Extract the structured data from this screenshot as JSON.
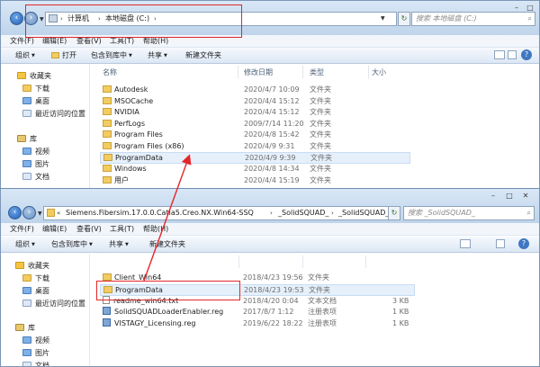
{
  "window1": {
    "address": [
      "计算机",
      "本地磁盘 (C:)"
    ],
    "search_placeholder": "搜索 本地磁盘 (C:)",
    "menu": [
      "文件(F)",
      "编辑(E)",
      "查看(V)",
      "工具(T)",
      "帮助(H)"
    ],
    "commands": [
      "组织",
      "打开",
      "包含到库中",
      "共享",
      "新建文件夹"
    ],
    "nav": [
      "收藏夹",
      "下载",
      "桌面",
      "最近访问的位置",
      "库",
      "视频",
      "图片",
      "文档"
    ],
    "headers": [
      "名称",
      "修改日期",
      "类型",
      "大小"
    ],
    "files": [
      {
        "name": "Autodesk",
        "date": "2020/4/7 10:09",
        "type": "文件夹",
        "size": ""
      },
      {
        "name": "MSOCache",
        "date": "2020/4/4 15:12",
        "type": "文件夹",
        "size": ""
      },
      {
        "name": "NVIDIA",
        "date": "2020/4/4 15:12",
        "type": "文件夹",
        "size": ""
      },
      {
        "name": "PerfLogs",
        "date": "2009/7/14 11:20",
        "type": "文件夹",
        "size": ""
      },
      {
        "name": "Program Files",
        "date": "2020/4/8 15:42",
        "type": "文件夹",
        "size": ""
      },
      {
        "name": "Program Files (x86)",
        "date": "2020/4/9 9:31",
        "type": "文件夹",
        "size": ""
      },
      {
        "name": "ProgramData",
        "date": "2020/4/9 9:39",
        "type": "文件夹",
        "size": ""
      },
      {
        "name": "Windows",
        "date": "2020/4/8 14:34",
        "type": "文件夹",
        "size": ""
      },
      {
        "name": "用户",
        "date": "2020/4/4 15:19",
        "type": "文件夹",
        "size": ""
      }
    ]
  },
  "window2": {
    "address": [
      "Siemens.Fibersim.17.0.0.Catia5.Creo.NX.Win64-SSQ",
      "_SolidSQUAD_",
      "_SolidSQUAD_"
    ],
    "search_placeholder": "搜索 _SolidSQUAD_",
    "menu": [
      "文件(F)",
      "编辑(E)",
      "查看(V)",
      "工具(T)",
      "帮助(H)"
    ],
    "commands": [
      "组织",
      "包含到库中",
      "共享",
      "新建文件夹"
    ],
    "nav": [
      "收藏夹",
      "下载",
      "桌面",
      "最近访问的位置",
      "库",
      "视频",
      "图片",
      "文档"
    ],
    "files": [
      {
        "name": "Client_Win64",
        "date": "2018/4/23 19:56",
        "type": "文件夹",
        "size": "",
        "kind": "folder"
      },
      {
        "name": "ProgramData",
        "date": "2018/4/23 19:53",
        "type": "文件夹",
        "size": "",
        "kind": "folder"
      },
      {
        "name": "readme_win64.txt",
        "date": "2018/4/20 0:04",
        "type": "文本文档",
        "size": "3 KB",
        "kind": "txt"
      },
      {
        "name": "SolidSQUADLoaderEnabler.reg",
        "date": "2017/8/7 1:12",
        "type": "注册表项",
        "size": "1 KB",
        "kind": "reg"
      },
      {
        "name": "VISTAGY_Licensing.reg",
        "date": "2019/6/22 18:22",
        "type": "注册表项",
        "size": "1 KB",
        "kind": "reg"
      }
    ]
  },
  "colors": {
    "annotation": "#e3262a",
    "selection": "#e6f0fb"
  }
}
